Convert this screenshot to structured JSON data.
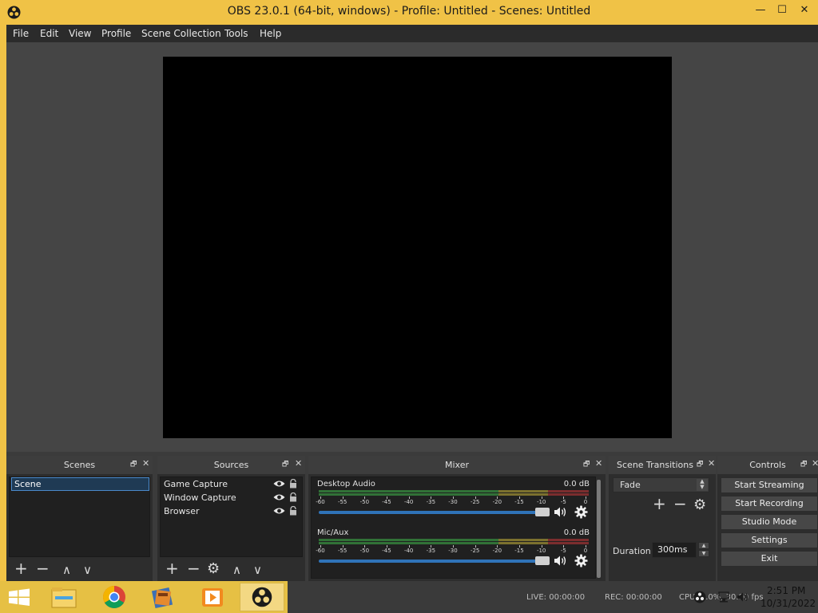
{
  "window": {
    "title": "OBS 23.0.1 (64-bit, windows) - Profile: Untitled - Scenes: Untitled",
    "minimize_glyph": "—",
    "maximize_glyph": "☐",
    "close_glyph": "✕"
  },
  "menu": [
    "File",
    "Edit",
    "View",
    "Profile",
    "Scene Collection",
    "Tools",
    "Help"
  ],
  "docks": {
    "scenes": {
      "title": "Scenes",
      "items": [
        "Scene"
      ]
    },
    "sources": {
      "title": "Sources",
      "items": [
        "Game Capture",
        "Window Capture",
        "Browser"
      ]
    },
    "mixer": {
      "title": "Mixer",
      "channels": [
        {
          "name": "Desktop Audio",
          "db": "0.0 dB",
          "level": 1.0
        },
        {
          "name": "Mic/Aux",
          "db": "0.0 dB",
          "level": 1.0
        }
      ],
      "ticks": [
        "-60",
        "-55",
        "-50",
        "-45",
        "-40",
        "-35",
        "-30",
        "-25",
        "-20",
        "-15",
        "-10",
        "-5",
        "0"
      ]
    },
    "transitions": {
      "title": "Scene Transitions",
      "selected": "Fade",
      "duration_label": "Duration",
      "duration_value": "300ms"
    },
    "controls": {
      "title": "Controls",
      "buttons": [
        "Start Streaming",
        "Start Recording",
        "Studio Mode",
        "Settings",
        "Exit"
      ]
    }
  },
  "glyphs": {
    "float": "🗗",
    "close": "✕",
    "add": "+",
    "remove": "−",
    "up": "∧",
    "down": "∨",
    "gear": "⚙"
  },
  "status": {
    "live": "LIVE: 00:00:00",
    "rec": "REC: 00:00:00",
    "cpu": "CPU: 0.0%, 30.00 fps"
  },
  "taskbar": {
    "icons": [
      "windows-start-icon",
      "file-explorer-icon",
      "chrome-icon",
      "movie-maker-icon",
      "media-player-icon",
      "obs-icon"
    ],
    "clock_time": "2:51 PM",
    "clock_date": "10/31/2022"
  },
  "colors": {
    "titlebar": "#f0c246",
    "accent": "#2f73b8",
    "meter_green": "#3fb64a",
    "meter_yellow": "#c8b43a",
    "meter_red": "#c8393a"
  }
}
